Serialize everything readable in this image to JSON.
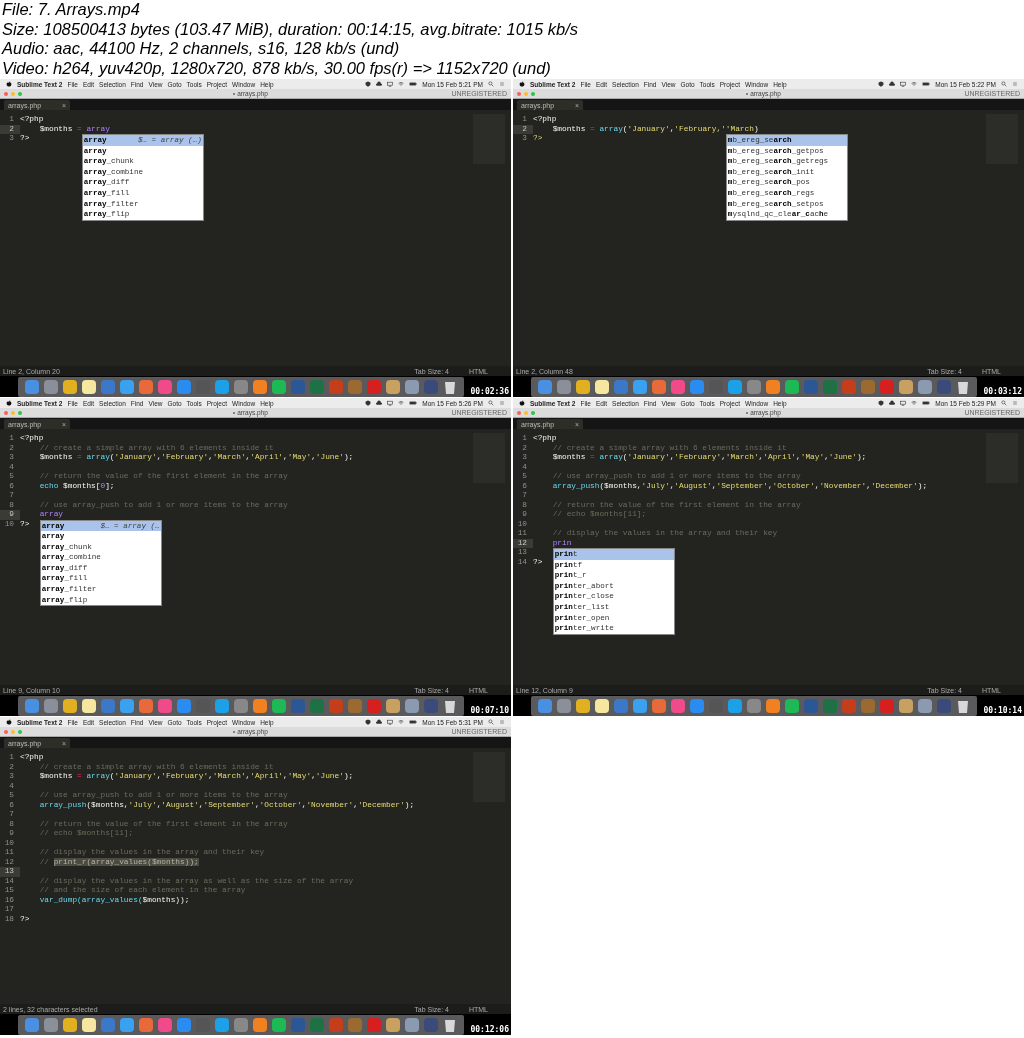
{
  "header": {
    "lines": [
      "File: 7. Arrays.mp4",
      "Size: 108500413 bytes (103.47 MiB), duration: 00:14:15, avg.bitrate: 1015 kb/s",
      "Audio: aac, 44100 Hz, 2 channels, s16, 128 kb/s (und)",
      "Video: h264, yuv420p, 1280x720, 878 kb/s, 30.00 fps(r) => 1152x720 (und)"
    ]
  },
  "frames": [
    {
      "menubar": {
        "app": "Sublime Text 2",
        "menus": [
          "File",
          "Edit",
          "Selection",
          "Find",
          "View",
          "Goto",
          "Tools",
          "Project",
          "Window",
          "Help"
        ],
        "clock": "Mon 15 Feb 5:21 PM"
      },
      "title": "arrays.php",
      "unregistered": "UNREGISTERED",
      "tab": "arrays.php",
      "tab_close": "×",
      "lines": [
        {
          "n": "1",
          "indent": false,
          "current": false,
          "tokens": [
            {
              "kind": "plain",
              "text": "<?php"
            }
          ]
        },
        {
          "n": "2",
          "indent": true,
          "current": true,
          "tokens": [
            {
              "kind": "var",
              "text": "$months "
            },
            {
              "kind": "op",
              "text": "="
            },
            {
              "kind": "typed",
              "text": " array",
              "popup": {
                "items": [
                  {
                    "label": "**array**",
                    "hint": "$… = array (…)",
                    "selected": true
                  },
                  {
                    "label": "**array**",
                    "selected": false
                  },
                  {
                    "label": "**array**_chunk",
                    "selected": false
                  },
                  {
                    "label": "**array**_combine",
                    "selected": false
                  },
                  {
                    "label": "**array**_diff",
                    "selected": false
                  },
                  {
                    "label": "**array**_fill",
                    "selected": false
                  },
                  {
                    "label": "**array**_filter",
                    "selected": false
                  },
                  {
                    "label": "**array**_flip",
                    "selected": false
                  }
                ]
              }
            }
          ]
        },
        {
          "n": "3",
          "indent": false,
          "current": false,
          "tokens": [
            {
              "kind": "plain",
              "text": "?>"
            }
          ]
        }
      ],
      "status": {
        "position": "Line 2, Column 20",
        "tab_size": "Tab Size: 4",
        "syntax": "HTML"
      },
      "timestamp": "00:02:36"
    },
    {
      "menubar": {
        "app": "Sublime Text 2",
        "menus": [
          "File",
          "Edit",
          "Selection",
          "Find",
          "View",
          "Goto",
          "Tools",
          "Project",
          "Window",
          "Help"
        ],
        "clock": "Mon 15 Feb 5:22 PM"
      },
      "title": "arrays.php",
      "unregistered": "UNREGISTERED",
      "tab": "arrays.php",
      "tab_close": "×",
      "lines": [
        {
          "n": "1",
          "indent": false,
          "current": false,
          "tokens": [
            {
              "kind": "plain",
              "text": "<?php"
            }
          ]
        },
        {
          "n": "2",
          "indent": true,
          "current": true,
          "tokens": [
            {
              "kind": "var",
              "text": "$months "
            },
            {
              "kind": "op",
              "text": "="
            },
            {
              "kind": "func",
              "text": " array"
            },
            {
              "kind": "plain",
              "text": "("
            },
            {
              "kind": "string",
              "text": "'January'"
            },
            {
              "kind": "plain",
              "text": ","
            },
            {
              "kind": "string",
              "text": "'February,'"
            },
            {
              "kind": "string",
              "text": "'March",
              "popup": {
                "items": [
                  {
                    "label": "**m**b_ereg_se**arch**",
                    "selected": true
                  },
                  {
                    "label": "**m**b_ereg_se**arch**_getpos",
                    "selected": false
                  },
                  {
                    "label": "**m**b_ereg_se**arch**_getregs",
                    "selected": false
                  },
                  {
                    "label": "**m**b_ereg_se**arch**_init",
                    "selected": false
                  },
                  {
                    "label": "**m**b_ereg_se**arch**_pos",
                    "selected": false
                  },
                  {
                    "label": "**m**b_ereg_se**arch**_regs",
                    "selected": false
                  },
                  {
                    "label": "**m**b_ereg_se**arch**_setpos",
                    "selected": false
                  },
                  {
                    "label": "**m**ysqlnd_qc_cle**ar**_**c**ac**h**e",
                    "selected": false
                  }
                ]
              }
            },
            {
              "kind": "plain",
              "text": ")"
            }
          ]
        },
        {
          "n": "3",
          "indent": false,
          "current": false,
          "tokens": [
            {
              "kind": "string",
              "text": "?>"
            }
          ]
        }
      ],
      "status": {
        "position": "Line 2, Column 48",
        "tab_size": "Tab Size: 4",
        "syntax": "HTML"
      },
      "timestamp": "00:03:12"
    },
    {
      "menubar": {
        "app": "Sublime Text 2",
        "menus": [
          "File",
          "Edit",
          "Selection",
          "Find",
          "View",
          "Goto",
          "Tools",
          "Project",
          "Window",
          "Help"
        ],
        "clock": "Mon 15 Feb 5:26 PM"
      },
      "title": "arrays.php",
      "unregistered": "UNREGISTERED",
      "tab": "arrays.php",
      "tab_close": "×",
      "lines": [
        {
          "n": "1",
          "indent": false,
          "current": false,
          "tokens": [
            {
              "kind": "plain",
              "text": "<?php"
            }
          ]
        },
        {
          "n": "2",
          "indent": true,
          "current": false,
          "tokens": [
            {
              "kind": "comment",
              "text": "// create a simple array with 6 elements inside it"
            }
          ]
        },
        {
          "n": "3",
          "indent": true,
          "current": false,
          "tokens": [
            {
              "kind": "var",
              "text": "$months "
            },
            {
              "kind": "op",
              "text": "="
            },
            {
              "kind": "func",
              "text": " array"
            },
            {
              "kind": "plain",
              "text": "("
            },
            {
              "kind": "string",
              "text": "'January'"
            },
            {
              "kind": "plain",
              "text": ","
            },
            {
              "kind": "string",
              "text": "'February'"
            },
            {
              "kind": "plain",
              "text": ","
            },
            {
              "kind": "string",
              "text": "'March'"
            },
            {
              "kind": "plain",
              "text": ","
            },
            {
              "kind": "string",
              "text": "'April'"
            },
            {
              "kind": "plain",
              "text": ","
            },
            {
              "kind": "string",
              "text": "'May'"
            },
            {
              "kind": "plain",
              "text": ","
            },
            {
              "kind": "string",
              "text": "'June'"
            },
            {
              "kind": "plain",
              "text": ");"
            }
          ]
        },
        {
          "n": "4",
          "current": false
        },
        {
          "n": "5",
          "indent": true,
          "current": false,
          "tokens": [
            {
              "kind": "comment",
              "text": "// return the value of the first element in the array"
            }
          ]
        },
        {
          "n": "6",
          "indent": true,
          "current": false,
          "tokens": [
            {
              "kind": "func",
              "text": "echo"
            },
            {
              "kind": "var",
              "text": " $months["
            },
            {
              "kind": "num",
              "text": "0"
            },
            {
              "kind": "var",
              "text": "];"
            }
          ]
        },
        {
          "n": "7",
          "current": false
        },
        {
          "n": "8",
          "indent": true,
          "current": false,
          "tokens": [
            {
              "kind": "comment",
              "text": "// use array_push to add 1 or more items to the array"
            }
          ]
        },
        {
          "n": "9",
          "indent": true,
          "current": true,
          "tokens": [
            {
              "kind": "typed",
              "text": "array",
              "popup": {
                "items": [
                  {
                    "label": "**array**",
                    "hint": "$… = array (…",
                    "selected": true
                  },
                  {
                    "label": "**array**",
                    "selected": false
                  },
                  {
                    "label": "**array**_chunk",
                    "selected": false
                  },
                  {
                    "label": "**array**_combine",
                    "selected": false
                  },
                  {
                    "label": "**array**_diff",
                    "selected": false
                  },
                  {
                    "label": "**array**_fill",
                    "selected": false
                  },
                  {
                    "label": "**array**_filter",
                    "selected": false
                  },
                  {
                    "label": "**array**_flip",
                    "selected": false
                  }
                ]
              }
            }
          ]
        },
        {
          "n": "10",
          "indent": false,
          "current": false,
          "tokens": [
            {
              "kind": "plain",
              "text": "?>"
            }
          ]
        }
      ],
      "status": {
        "position": "Line 9, Column 10",
        "tab_size": "Tab Size: 4",
        "syntax": "HTML"
      },
      "timestamp": "00:07:10"
    },
    {
      "menubar": {
        "app": "Sublime Text 2",
        "menus": [
          "File",
          "Edit",
          "Selection",
          "Find",
          "View",
          "Goto",
          "Tools",
          "Project",
          "Window",
          "Help"
        ],
        "clock": "Mon 15 Feb 5:29 PM"
      },
      "title": "arrays.php",
      "unregistered": "UNREGISTERED",
      "tab": "arrays.php",
      "tab_close": "×",
      "lines": [
        {
          "n": "1",
          "indent": false,
          "current": false,
          "tokens": [
            {
              "kind": "plain",
              "text": "<?php"
            }
          ]
        },
        {
          "n": "2",
          "indent": true,
          "current": false,
          "tokens": [
            {
              "kind": "comment",
              "text": "// create a simple array with 6 elements inside it"
            }
          ]
        },
        {
          "n": "3",
          "indent": true,
          "current": false,
          "tokens": [
            {
              "kind": "var",
              "text": "$months "
            },
            {
              "kind": "op",
              "text": "="
            },
            {
              "kind": "func",
              "text": " array"
            },
            {
              "kind": "plain",
              "text": "("
            },
            {
              "kind": "string",
              "text": "'January'"
            },
            {
              "kind": "plain",
              "text": ","
            },
            {
              "kind": "string",
              "text": "'February'"
            },
            {
              "kind": "plain",
              "text": ","
            },
            {
              "kind": "string",
              "text": "'March'"
            },
            {
              "kind": "plain",
              "text": ","
            },
            {
              "kind": "string",
              "text": "'April'"
            },
            {
              "kind": "plain",
              "text": ","
            },
            {
              "kind": "string",
              "text": "'May'"
            },
            {
              "kind": "plain",
              "text": ","
            },
            {
              "kind": "string",
              "text": "'June'"
            },
            {
              "kind": "plain",
              "text": ");"
            }
          ]
        },
        {
          "n": "4",
          "current": false
        },
        {
          "n": "5",
          "indent": true,
          "current": false,
          "tokens": [
            {
              "kind": "comment",
              "text": "// use array_push to add 1 or more items to the array"
            }
          ]
        },
        {
          "n": "6",
          "indent": true,
          "current": false,
          "tokens": [
            {
              "kind": "func",
              "text": "array_push"
            },
            {
              "kind": "plain",
              "text": "($months,"
            },
            {
              "kind": "string",
              "text": "'July'"
            },
            {
              "kind": "plain",
              "text": ","
            },
            {
              "kind": "string",
              "text": "'August'"
            },
            {
              "kind": "plain",
              "text": ","
            },
            {
              "kind": "string",
              "text": "'September'"
            },
            {
              "kind": "plain",
              "text": ","
            },
            {
              "kind": "string",
              "text": "'October'"
            },
            {
              "kind": "plain",
              "text": ","
            },
            {
              "kind": "string",
              "text": "'November'"
            },
            {
              "kind": "plain",
              "text": ","
            },
            {
              "kind": "string",
              "text": "'December'"
            },
            {
              "kind": "plain",
              "text": ");"
            }
          ]
        },
        {
          "n": "7",
          "current": false
        },
        {
          "n": "8",
          "indent": true,
          "current": false,
          "tokens": [
            {
              "kind": "comment",
              "text": "// return the value of the first element in the array"
            }
          ]
        },
        {
          "n": "9",
          "indent": true,
          "current": false,
          "tokens": [
            {
              "kind": "comment",
              "text": "// echo $months[11];"
            }
          ]
        },
        {
          "n": "10",
          "current": false
        },
        {
          "n": "11",
          "indent": true,
          "current": false,
          "tokens": [
            {
              "kind": "comment",
              "text": "// display the values in the array and their key"
            }
          ]
        },
        {
          "n": "12",
          "indent": true,
          "current": true,
          "tokens": [
            {
              "kind": "typed",
              "text": "prin",
              "popup": {
                "items": [
                  {
                    "label": "**prin**t",
                    "selected": true
                  },
                  {
                    "label": "**prin**tf",
                    "selected": false
                  },
                  {
                    "label": "**prin**t_r",
                    "selected": false
                  },
                  {
                    "label": "**prin**ter_abort",
                    "selected": false
                  },
                  {
                    "label": "**prin**ter_close",
                    "selected": false
                  },
                  {
                    "label": "**prin**ter_list",
                    "selected": false
                  },
                  {
                    "label": "**prin**ter_open",
                    "selected": false
                  },
                  {
                    "label": "**prin**ter_write",
                    "selected": false
                  }
                ]
              }
            }
          ]
        },
        {
          "n": "13",
          "current": false
        },
        {
          "n": "14",
          "indent": false,
          "current": false,
          "tokens": [
            {
              "kind": "plain",
              "text": "?>"
            }
          ]
        }
      ],
      "status": {
        "position": "Line 12, Column 9",
        "tab_size": "Tab Size: 4",
        "syntax": "HTML"
      },
      "timestamp": "00:10:14"
    },
    {
      "menubar": {
        "app": "Sublime Text 2",
        "menus": [
          "File",
          "Edit",
          "Selection",
          "Find",
          "View",
          "Goto",
          "Tools",
          "Project",
          "Window",
          "Help"
        ],
        "clock": "Mon 15 Feb 5:31 PM"
      },
      "title": "arrays.php",
      "unregistered": "UNREGISTERED",
      "tab": "arrays.php",
      "tab_close": "×",
      "lines": [
        {
          "n": "1",
          "indent": false,
          "current": false,
          "tokens": [
            {
              "kind": "plain",
              "text": "<?php"
            }
          ]
        },
        {
          "n": "2",
          "indent": true,
          "current": false,
          "tokens": [
            {
              "kind": "comment",
              "text": "// create a simple array with 6 elements inside it"
            }
          ]
        },
        {
          "n": "3",
          "indent": true,
          "current": false,
          "tokens": [
            {
              "kind": "var",
              "text": "$months "
            },
            {
              "kind": "op",
              "text": "="
            },
            {
              "kind": "func",
              "text": " array"
            },
            {
              "kind": "plain",
              "text": "("
            },
            {
              "kind": "string",
              "text": "'January'"
            },
            {
              "kind": "plain",
              "text": ","
            },
            {
              "kind": "string",
              "text": "'February'"
            },
            {
              "kind": "plain",
              "text": ","
            },
            {
              "kind": "string",
              "text": "'March'"
            },
            {
              "kind": "plain",
              "text": ","
            },
            {
              "kind": "string",
              "text": "'April'"
            },
            {
              "kind": "plain",
              "text": ","
            },
            {
              "kind": "string",
              "text": "'May'"
            },
            {
              "kind": "plain",
              "text": ","
            },
            {
              "kind": "string",
              "text": "'June'"
            },
            {
              "kind": "plain",
              "text": ");"
            }
          ]
        },
        {
          "n": "4",
          "current": false
        },
        {
          "n": "5",
          "indent": true,
          "current": false,
          "tokens": [
            {
              "kind": "comment",
              "text": "// use array_push to add 1 or more items to the array"
            }
          ]
        },
        {
          "n": "6",
          "indent": true,
          "current": false,
          "tokens": [
            {
              "kind": "func",
              "text": "array_push"
            },
            {
              "kind": "plain",
              "text": "($months,"
            },
            {
              "kind": "string",
              "text": "'July'"
            },
            {
              "kind": "plain",
              "text": ","
            },
            {
              "kind": "string",
              "text": "'August'"
            },
            {
              "kind": "plain",
              "text": ","
            },
            {
              "kind": "string",
              "text": "'September'"
            },
            {
              "kind": "plain",
              "text": ","
            },
            {
              "kind": "string",
              "text": "'October'"
            },
            {
              "kind": "plain",
              "text": ","
            },
            {
              "kind": "string",
              "text": "'November'"
            },
            {
              "kind": "plain",
              "text": ","
            },
            {
              "kind": "string",
              "text": "'December'"
            },
            {
              "kind": "plain",
              "text": ");"
            }
          ]
        },
        {
          "n": "7",
          "current": false
        },
        {
          "n": "8",
          "indent": true,
          "current": false,
          "tokens": [
            {
              "kind": "comment",
              "text": "// return the value of the first element in the array"
            }
          ]
        },
        {
          "n": "9",
          "indent": true,
          "current": false,
          "tokens": [
            {
              "kind": "comment",
              "text": "// echo $months[11];"
            }
          ]
        },
        {
          "n": "10",
          "current": false
        },
        {
          "n": "11",
          "indent": true,
          "current": false,
          "tokens": [
            {
              "kind": "comment",
              "text": "// display the values in the array and their key"
            }
          ]
        },
        {
          "n": "12",
          "indent": true,
          "current": false,
          "tokens": [
            {
              "kind": "comment",
              "text": "// "
            },
            {
              "kind": "comment",
              "text": "print_r(array_values($months));",
              "highlight": true
            }
          ]
        },
        {
          "n": "13",
          "current": true
        },
        {
          "n": "14",
          "indent": true,
          "current": false,
          "tokens": [
            {
              "kind": "comment",
              "text": "// display the values in the array as well as the size of the array"
            }
          ]
        },
        {
          "n": "15",
          "indent": true,
          "current": false,
          "tokens": [
            {
              "kind": "comment",
              "text": "// and the size of each element in the array"
            }
          ]
        },
        {
          "n": "16",
          "indent": true,
          "current": false,
          "tokens": [
            {
              "kind": "func",
              "text": "var_dump(array_values("
            },
            {
              "kind": "var",
              "text": "$months"
            },
            {
              "kind": "plain",
              "text": "));"
            }
          ]
        },
        {
          "n": "17",
          "current": false
        },
        {
          "n": "18",
          "indent": false,
          "current": false,
          "tokens": [
            {
              "kind": "plain",
              "text": "?>"
            }
          ]
        }
      ],
      "status": {
        "position": "2 lines, 32 characters selected",
        "tab_size": "Tab Size: 4",
        "syntax": "HTML"
      },
      "timestamp": "00:12:06"
    }
  ]
}
